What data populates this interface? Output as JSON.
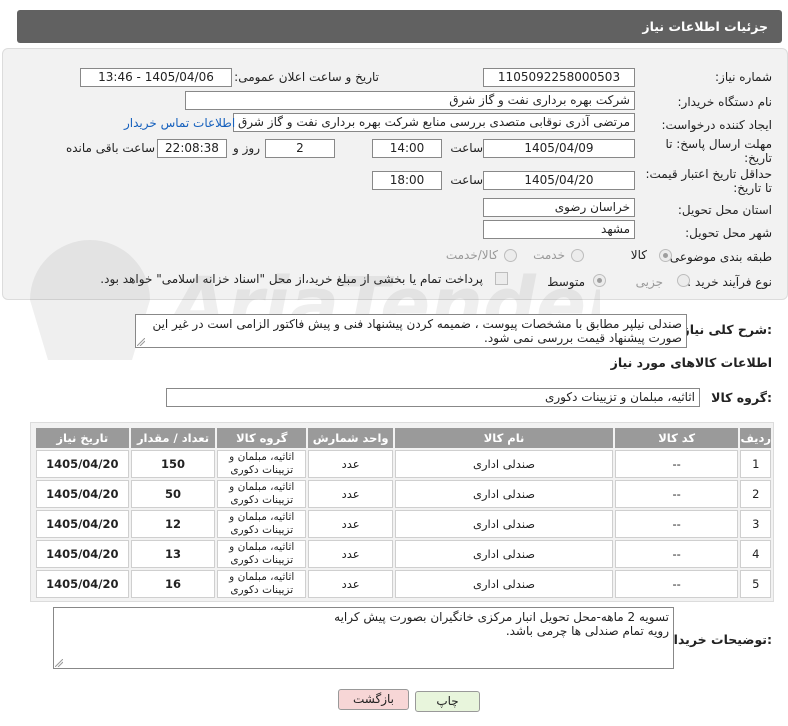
{
  "header": {
    "title": "جزئیات اطلاعات نیاز"
  },
  "form": {
    "need_number_label": "شماره نیاز:",
    "need_number": "1105092258000503",
    "announce_label": "تاریخ و ساعت اعلان عمومی:",
    "announce_value": "1405/04/06 - 13:46",
    "buyer_org_label": "نام دستگاه خریدار:",
    "buyer_org": "شرکت بهره برداری نفت و گاز شرق",
    "requester_label": "ایجاد کننده درخواست:",
    "requester": "مرتضی آذری نوقابی متصدی بررسی منابع شرکت بهره برداری نفت و گاز شرق",
    "contact_link": "اطلاعات تماس خریدار",
    "deadline_label_1": "مهلت ارسال پاسخ: تا",
    "deadline_label_2": "تاریخ:",
    "deadline_date": "1405/04/09",
    "time_label": "ساعت",
    "deadline_time": "14:00",
    "day_label": "روز و",
    "days": "2",
    "remaining_time": "22:08:38",
    "remaining_label": "ساعت باقی مانده",
    "validity_label_1": "حداقل تاریخ اعتبار قیمت:",
    "validity_label_2": "تا تاریخ:",
    "validity_date": "1405/04/20",
    "validity_time": "18:00",
    "province_label": "استان محل تحویل:",
    "province": "خراسان رضوی",
    "city_label": "شهر محل تحویل:",
    "city": "مشهد",
    "category_label": "طبقه بندی موضوعی:",
    "category_options": [
      "کالا",
      "خدمت",
      "کالا/خدمت"
    ],
    "category_selected": "کالا",
    "process_label": "نوع فرآیند خرید :",
    "process_options": [
      "جزیی",
      "متوسط"
    ],
    "process_selected": "متوسط",
    "payment_note": "پرداخت تمام یا بخشی از مبلغ خرید،از محل \"اسناد خزانه اسلامی\" خواهد بود."
  },
  "description": {
    "label": "شرح کلی نیاز:",
    "text": "صندلی نیلپر مطابق با مشخصات پیوست ، ضمیمه کردن پیشنهاد فنی و پیش فاکتور الزامی است در غیر این صورت پیشنهاد قیمت بررسی نمی شود."
  },
  "goods_section": {
    "title": "اطلاعات کالاهای مورد نیاز",
    "group_label": "گروه کالا:",
    "group_value": "اثاثیه، مبلمان و تزیینات دکوری"
  },
  "table": {
    "headers": [
      "ردیف",
      "کد کالا",
      "نام کالا",
      "واحد شمارش",
      "گروه کالا",
      "تعداد / مقدار",
      "تاریخ نیاز"
    ],
    "rows": [
      {
        "row": "1",
        "code": "--",
        "name": "صندلی اداری",
        "unit": "عدد",
        "group_1": "اثاثیه، مبلمان و",
        "group_2": "تزیینات دکوری",
        "qty": "150",
        "date": "1405/04/20"
      },
      {
        "row": "2",
        "code": "--",
        "name": "صندلی اداری",
        "unit": "عدد",
        "group_1": "اثاثیه، مبلمان و",
        "group_2": "تزیینات دکوری",
        "qty": "50",
        "date": "1405/04/20"
      },
      {
        "row": "3",
        "code": "--",
        "name": "صندلی اداری",
        "unit": "عدد",
        "group_1": "اثاثیه، مبلمان و",
        "group_2": "تزیینات دکوری",
        "qty": "12",
        "date": "1405/04/20"
      },
      {
        "row": "4",
        "code": "--",
        "name": "صندلی اداری",
        "unit": "عدد",
        "group_1": "اثاثیه، مبلمان و",
        "group_2": "تزیینات دکوری",
        "qty": "13",
        "date": "1405/04/20"
      },
      {
        "row": "5",
        "code": "--",
        "name": "صندلی اداری",
        "unit": "عدد",
        "group_1": "اثاثیه، مبلمان و",
        "group_2": "تزیینات دکوری",
        "qty": "16",
        "date": "1405/04/20"
      }
    ]
  },
  "buyer_notes": {
    "label": "توضیحات خریدار:",
    "line_1": "تسویه 2 ماهه-محل تحویل انبار مرکزی خانگیران بصورت پیش کرایه",
    "line_2": "رویه تمام صندلی ها چرمی باشد."
  },
  "buttons": {
    "print": "چاپ",
    "back": "بازگشت"
  },
  "colors": {
    "header_bg": "#616161",
    "link": "#1560bd",
    "back_button": "#f7d6d6",
    "print_button": "#e8f5dc"
  },
  "watermark": {
    "text": "AriaTender.net"
  }
}
